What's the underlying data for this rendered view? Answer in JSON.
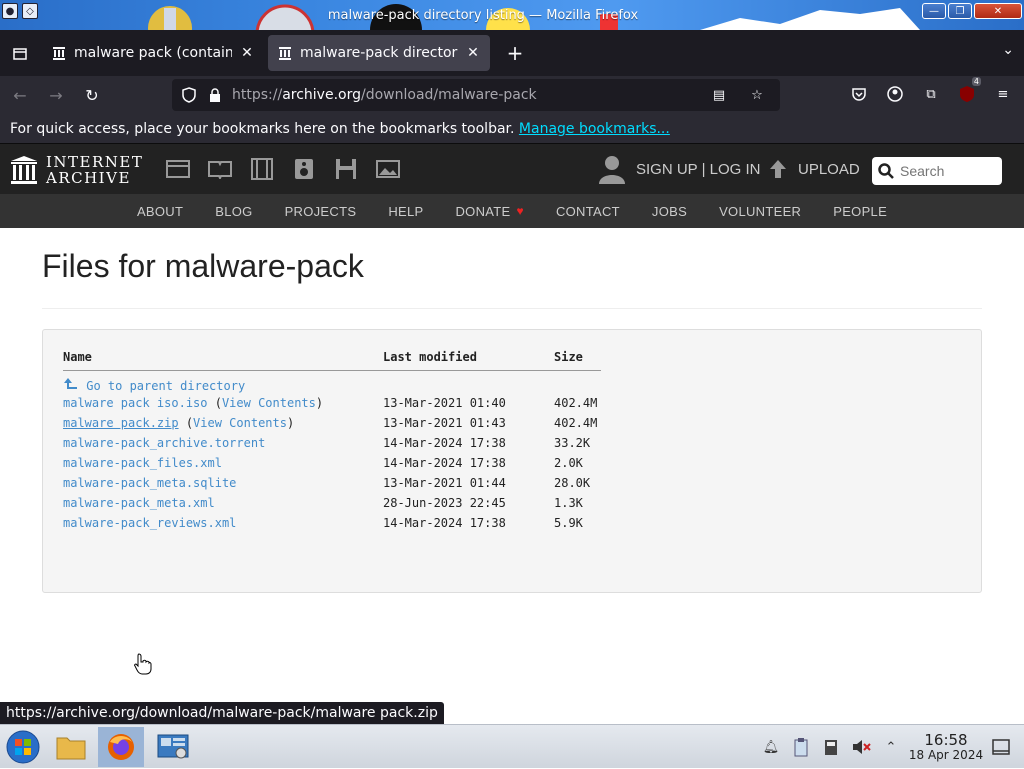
{
  "window": {
    "title": "malware-pack directory listing — Mozilla Firefox"
  },
  "tabs": [
    {
      "label": "malware pack (contains",
      "active": false
    },
    {
      "label": "malware-pack directory",
      "active": true
    }
  ],
  "navbar": {
    "url_prefix": "https://",
    "url_host": "archive.org",
    "url_path": "/download/malware-pack",
    "extensions_badge": "4"
  },
  "bookmarks_bar": {
    "text": "For quick access, place your bookmarks here on the bookmarks toolbar.",
    "link": "Manage bookmarks..."
  },
  "ia_header": {
    "logo_line1": "INTERNET",
    "logo_line2": "ARCHIVE",
    "user_links": "SIGN UP | LOG IN",
    "upload": "UPLOAD",
    "search_placeholder": "Search",
    "nav": [
      "ABOUT",
      "BLOG",
      "PROJECTS",
      "HELP",
      "DONATE",
      "CONTACT",
      "JOBS",
      "VOLUNTEER",
      "PEOPLE"
    ]
  },
  "page": {
    "title": "Files for malware-pack",
    "columns": [
      "Name",
      "Last modified",
      "Size"
    ],
    "parent_link": "Go to parent directory",
    "view_contents": "View Contents",
    "files": [
      {
        "name": "malware pack iso.iso",
        "view": true,
        "modified": "13-Mar-2021 01:40",
        "size": "402.4M"
      },
      {
        "name": "malware pack.zip",
        "view": true,
        "modified": "13-Mar-2021 01:43",
        "size": "402.4M"
      },
      {
        "name": "malware-pack_archive.torrent",
        "view": false,
        "modified": "14-Mar-2024 17:38",
        "size": "33.2K"
      },
      {
        "name": "malware-pack_files.xml",
        "view": false,
        "modified": "14-Mar-2024 17:38",
        "size": "2.0K"
      },
      {
        "name": "malware-pack_meta.sqlite",
        "view": false,
        "modified": "13-Mar-2021 01:44",
        "size": "28.0K"
      },
      {
        "name": "malware-pack_meta.xml",
        "view": false,
        "modified": "28-Jun-2023 22:45",
        "size": "1.3K"
      },
      {
        "name": "malware-pack_reviews.xml",
        "view": false,
        "modified": "14-Mar-2024 17:38",
        "size": "5.9K"
      }
    ]
  },
  "status_url": "https://archive.org/download/malware-pack/malware pack.zip",
  "taskbar": {
    "time": "16:58",
    "date": "18 Apr 2024"
  },
  "colors": {
    "link": "#428bca",
    "firefox_chrome": "#2b2a33",
    "ia_dark": "#222222"
  }
}
